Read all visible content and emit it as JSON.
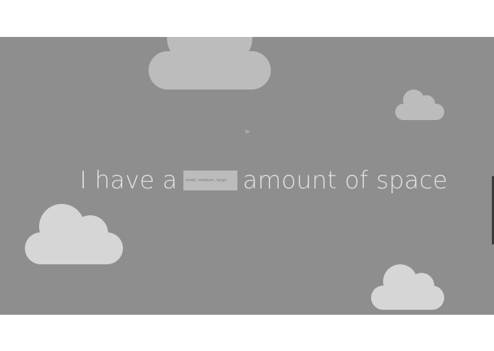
{
  "sentence": {
    "prefix": "I have a",
    "input_placeholder": "small, medium, large",
    "input_value": "",
    "suffix": "amount of space"
  },
  "nav": {
    "next_glyph": ">"
  }
}
